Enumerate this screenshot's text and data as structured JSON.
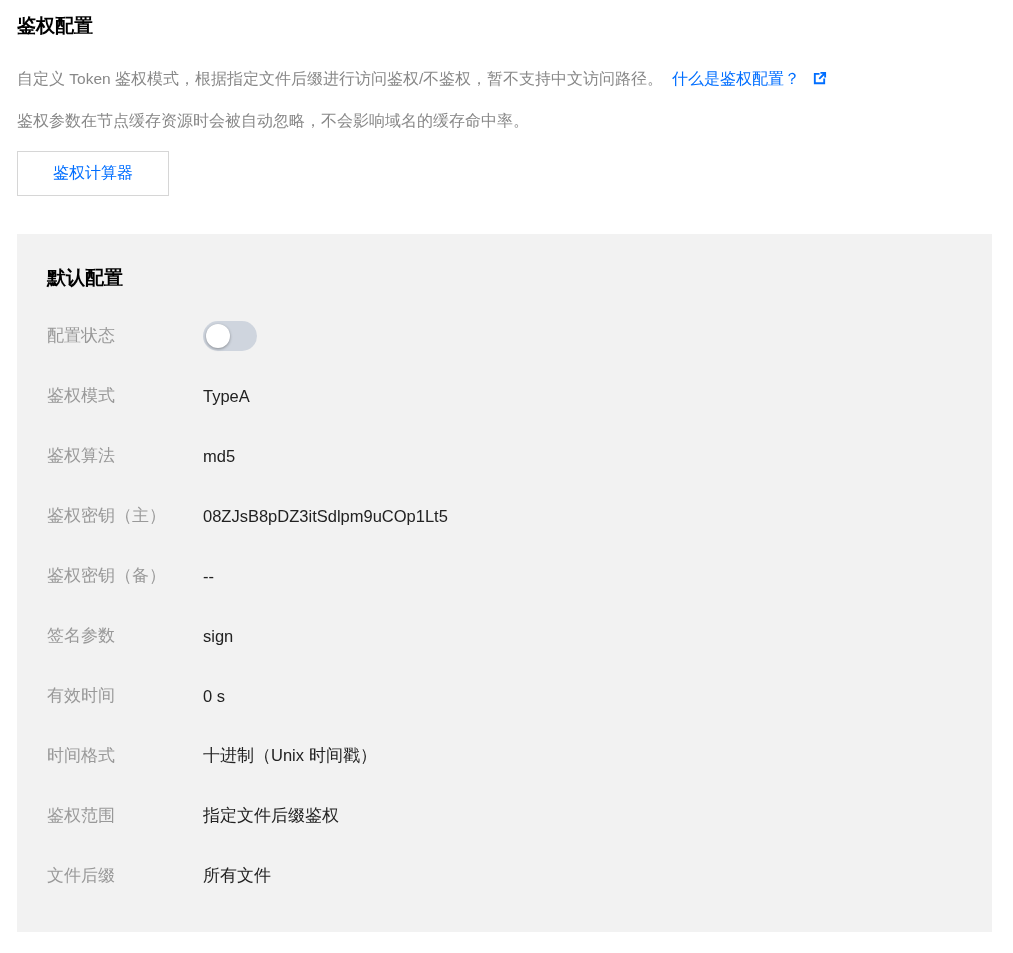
{
  "title": "鉴权配置",
  "description": {
    "text": "自定义 Token 鉴权模式，根据指定文件后缀进行访问鉴权/不鉴权，暂不支持中文访问路径。",
    "link": "什么是鉴权配置？"
  },
  "note": "鉴权参数在节点缓存资源时会被自动忽略，不会影响域名的缓存命中率。",
  "calculator_button": "鉴权计算器",
  "panel": {
    "title": "默认配置",
    "rows": [
      {
        "kind": "toggle",
        "label": "配置状态",
        "on": false
      },
      {
        "kind": "text",
        "label": "鉴权模式",
        "value": "TypeA"
      },
      {
        "kind": "text",
        "label": "鉴权算法",
        "value": "md5"
      },
      {
        "kind": "text",
        "label": "鉴权密钥（主）",
        "value": "08ZJsB8pDZ3itSdlpm9uCOp1Lt5"
      },
      {
        "kind": "text",
        "label": "鉴权密钥（备）",
        "value": "--"
      },
      {
        "kind": "text",
        "label": "签名参数",
        "value": "sign"
      },
      {
        "kind": "text",
        "label": "有效时间",
        "value": "0 s"
      },
      {
        "kind": "text",
        "label": "时间格式",
        "value": "十进制（Unix 时间戳）"
      },
      {
        "kind": "text",
        "label": "鉴权范围",
        "value": "指定文件后缀鉴权"
      },
      {
        "kind": "text",
        "label": "文件后缀",
        "value": "所有文件"
      }
    ]
  }
}
